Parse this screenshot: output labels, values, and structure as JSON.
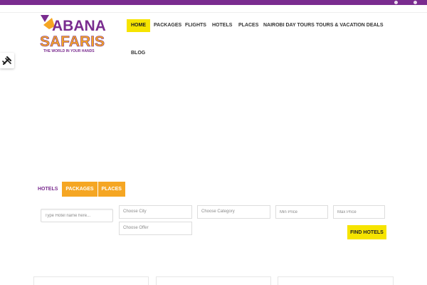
{
  "brand": {
    "logo_line1": "ABANA",
    "logo_line2": "SAFARIS",
    "logo_tagline": "THE WORLD IN YOUR HANDS",
    "primary_color": "#7a2c8f",
    "accent_yellow": "#f6e400",
    "accent_orange": "#f5a623"
  },
  "topbar": {
    "icons": [
      "user-icon",
      "lock-icon"
    ]
  },
  "nav": {
    "items": [
      {
        "label": "HOME",
        "active": true
      },
      {
        "label": "PACKAGES",
        "active": false
      },
      {
        "label": "FLIGHTS",
        "active": false
      },
      {
        "label": "HOTELS",
        "active": false
      },
      {
        "label": "PLACES",
        "active": false
      },
      {
        "label": "NAIROBI DAY TOURS",
        "active": false
      },
      {
        "label": "TOURS & VACATION DEALS",
        "active": false
      },
      {
        "label": "BLOG",
        "active": false
      }
    ]
  },
  "side_tool": {
    "icon": "tools-icon"
  },
  "search": {
    "tabs": [
      {
        "label": "HOTELS",
        "active": true
      },
      {
        "label": "PACKAGES",
        "active": false
      },
      {
        "label": "PLACES",
        "active": false
      }
    ],
    "hotel_name_placeholder": "Type Hotel name here...",
    "city_value": "Choose City",
    "category_value": "Choose Category",
    "min_price_placeholder": "Min Price",
    "max_price_placeholder": "Max Price",
    "offer_value": "Choose Offer",
    "submit_label": "FIND HOTELS"
  }
}
